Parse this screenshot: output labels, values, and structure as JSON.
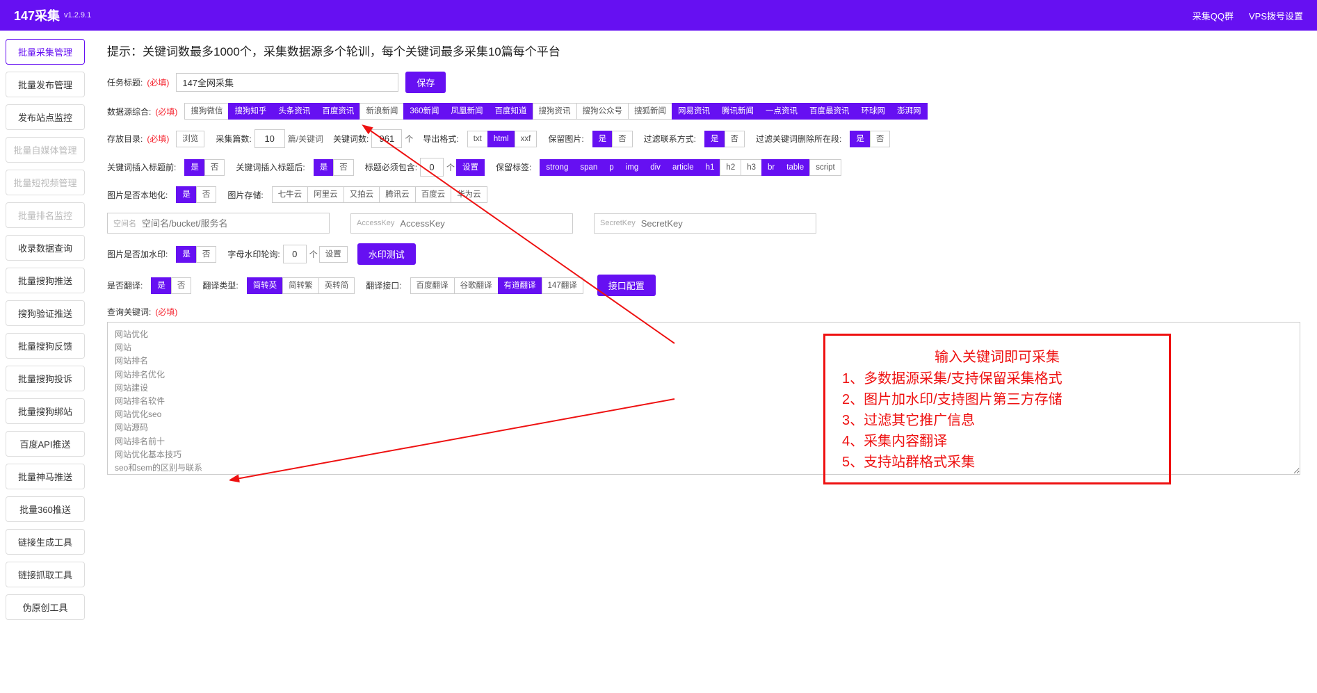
{
  "header": {
    "brand": "147采集",
    "version": "v1.2.9.1",
    "links": [
      "采集QQ群",
      "VPS拨号设置"
    ]
  },
  "sidebar": {
    "items": [
      {
        "label": "批量采集管理",
        "state": "active"
      },
      {
        "label": "批量发布管理",
        "state": ""
      },
      {
        "label": "发布站点监控",
        "state": ""
      },
      {
        "label": "批量自媒体管理",
        "state": "disabled"
      },
      {
        "label": "批量短视频管理",
        "state": "disabled"
      },
      {
        "label": "批量排名监控",
        "state": "disabled"
      },
      {
        "label": "收录数据查询",
        "state": ""
      },
      {
        "label": "批量搜狗推送",
        "state": ""
      },
      {
        "label": "搜狗验证推送",
        "state": ""
      },
      {
        "label": "批量搜狗反馈",
        "state": ""
      },
      {
        "label": "批量搜狗投诉",
        "state": ""
      },
      {
        "label": "批量搜狗绑站",
        "state": ""
      },
      {
        "label": "百度API推送",
        "state": ""
      },
      {
        "label": "批量神马推送",
        "state": ""
      },
      {
        "label": "批量360推送",
        "state": ""
      },
      {
        "label": "链接生成工具",
        "state": ""
      },
      {
        "label": "链接抓取工具",
        "state": ""
      },
      {
        "label": "伪原创工具",
        "state": ""
      }
    ]
  },
  "main": {
    "hint": "提示：关键词数最多1000个，采集数据源多个轮训，每个关键词最多采集10篇每个平台",
    "taskTitleLabel": "任务标题:",
    "required": "(必填)",
    "taskTitleValue": "147全网采集",
    "saveBtn": "保存",
    "sourceLabel": "数据源综合:",
    "sources": [
      {
        "t": "搜狗微信",
        "on": false
      },
      {
        "t": "搜狗知乎",
        "on": true
      },
      {
        "t": "头条资讯",
        "on": true
      },
      {
        "t": "百度资讯",
        "on": true
      },
      {
        "t": "新浪新闻",
        "on": false
      },
      {
        "t": "360新闻",
        "on": true
      },
      {
        "t": "凤凰新闻",
        "on": true
      },
      {
        "t": "百度知道",
        "on": true
      },
      {
        "t": "搜狗资讯",
        "on": false
      },
      {
        "t": "搜狗公众号",
        "on": false
      },
      {
        "t": "搜狐新闻",
        "on": false
      },
      {
        "t": "网易资讯",
        "on": true
      },
      {
        "t": "腾讯新闻",
        "on": true
      },
      {
        "t": "一点资讯",
        "on": true
      },
      {
        "t": "百度最资讯",
        "on": true
      },
      {
        "t": "环球网",
        "on": true
      },
      {
        "t": "澎湃网",
        "on": true
      }
    ],
    "saveDirLabel": "存放目录:",
    "browse": "浏览",
    "countLabel": "采集篇数:",
    "countValue": "10",
    "countUnit": "篇/关键词",
    "kwCountLabel": "关键词数:",
    "kwCountValue": "961",
    "kwCountUnit": "个",
    "exportLabel": "导出格式:",
    "exportFormats": [
      {
        "t": "txt",
        "on": false
      },
      {
        "t": "html",
        "on": true
      },
      {
        "t": "xxf",
        "on": false
      }
    ],
    "keepImgLabel": "保留图片:",
    "yesno": [
      {
        "t": "是",
        "on": true
      },
      {
        "t": "否",
        "on": false
      }
    ],
    "filterContactLabel": "过滤联系方式:",
    "filterKwDelLabel": "过滤关键词删除所在段:",
    "kwInsertTitleBefore": "关键词插入标题前:",
    "kwInsertTitleAfter": "关键词插入标题后:",
    "titleMustContain": "标题必须包含:",
    "titleMustValue": "0",
    "titleMustUnit": "个",
    "buildBtn": "设置",
    "keepTagsLabel": "保留标签:",
    "keepTags": [
      {
        "t": "strong",
        "on": true
      },
      {
        "t": "span",
        "on": true
      },
      {
        "t": "p",
        "on": true
      },
      {
        "t": "img",
        "on": true
      },
      {
        "t": "div",
        "on": true
      },
      {
        "t": "article",
        "on": true
      },
      {
        "t": "h1",
        "on": true
      },
      {
        "t": "h2",
        "on": false
      },
      {
        "t": "h3",
        "on": false
      },
      {
        "t": "br",
        "on": true
      },
      {
        "t": "table",
        "on": true
      },
      {
        "t": "script",
        "on": false
      }
    ],
    "imgLocalLabel": "图片是否本地化:",
    "imgStoreLabel": "图片存储:",
    "imgStores": [
      {
        "t": "七牛云",
        "on": false
      },
      {
        "t": "阿里云",
        "on": false
      },
      {
        "t": "又拍云",
        "on": false
      },
      {
        "t": "腾讯云",
        "on": false
      },
      {
        "t": "百度云",
        "on": false
      },
      {
        "t": "华为云",
        "on": false
      }
    ],
    "spaceLabel": "空间名",
    "spacePh": "空间名/bucket/服务名",
    "akLabel": "AccessKey",
    "akPh": "AccessKey",
    "skLabel": "SecretKey",
    "skPh": "SecretKey",
    "watermarkLabel": "图片是否加水印:",
    "alphaWmLabel": "字母水印轮询:",
    "alphaWmValue": "0",
    "alphaWmUnit": "个",
    "wmTestBtn": "水印测试",
    "translateLabel": "是否翻译:",
    "transTypeLabel": "翻译类型:",
    "transTypes": [
      {
        "t": "简转英",
        "on": true
      },
      {
        "t": "简转繁",
        "on": false
      },
      {
        "t": "英转简",
        "on": false
      }
    ],
    "transApiLabel": "翻译接口:",
    "transApis": [
      {
        "t": "百度翻译",
        "on": false
      },
      {
        "t": "谷歌翻译",
        "on": false
      },
      {
        "t": "有道翻译",
        "on": true
      },
      {
        "t": "147翻译",
        "on": false
      }
    ],
    "apiConfigBtn": "接口配置",
    "queryKwLabel": "查询关键词:",
    "keywords": "网站优化\n网站\n网站排名\n网站排名优化\n网站建设\n网站排名软件\n网站优化seo\n网站源码\n网站排名前十\n网站优化基本技巧\nseo和sem的区别与联系\n网站搭建\n网站排名查询\n网站优化培训\nseo是什么意思"
  },
  "callout": {
    "title": "输入关键词即可采集",
    "lines": [
      "1、多数据源采集/支持保留采集格式",
      "2、图片加水印/支持图片第三方存储",
      "3、过滤其它推广信息",
      "4、采集内容翻译",
      "5、支持站群格式采集"
    ]
  }
}
